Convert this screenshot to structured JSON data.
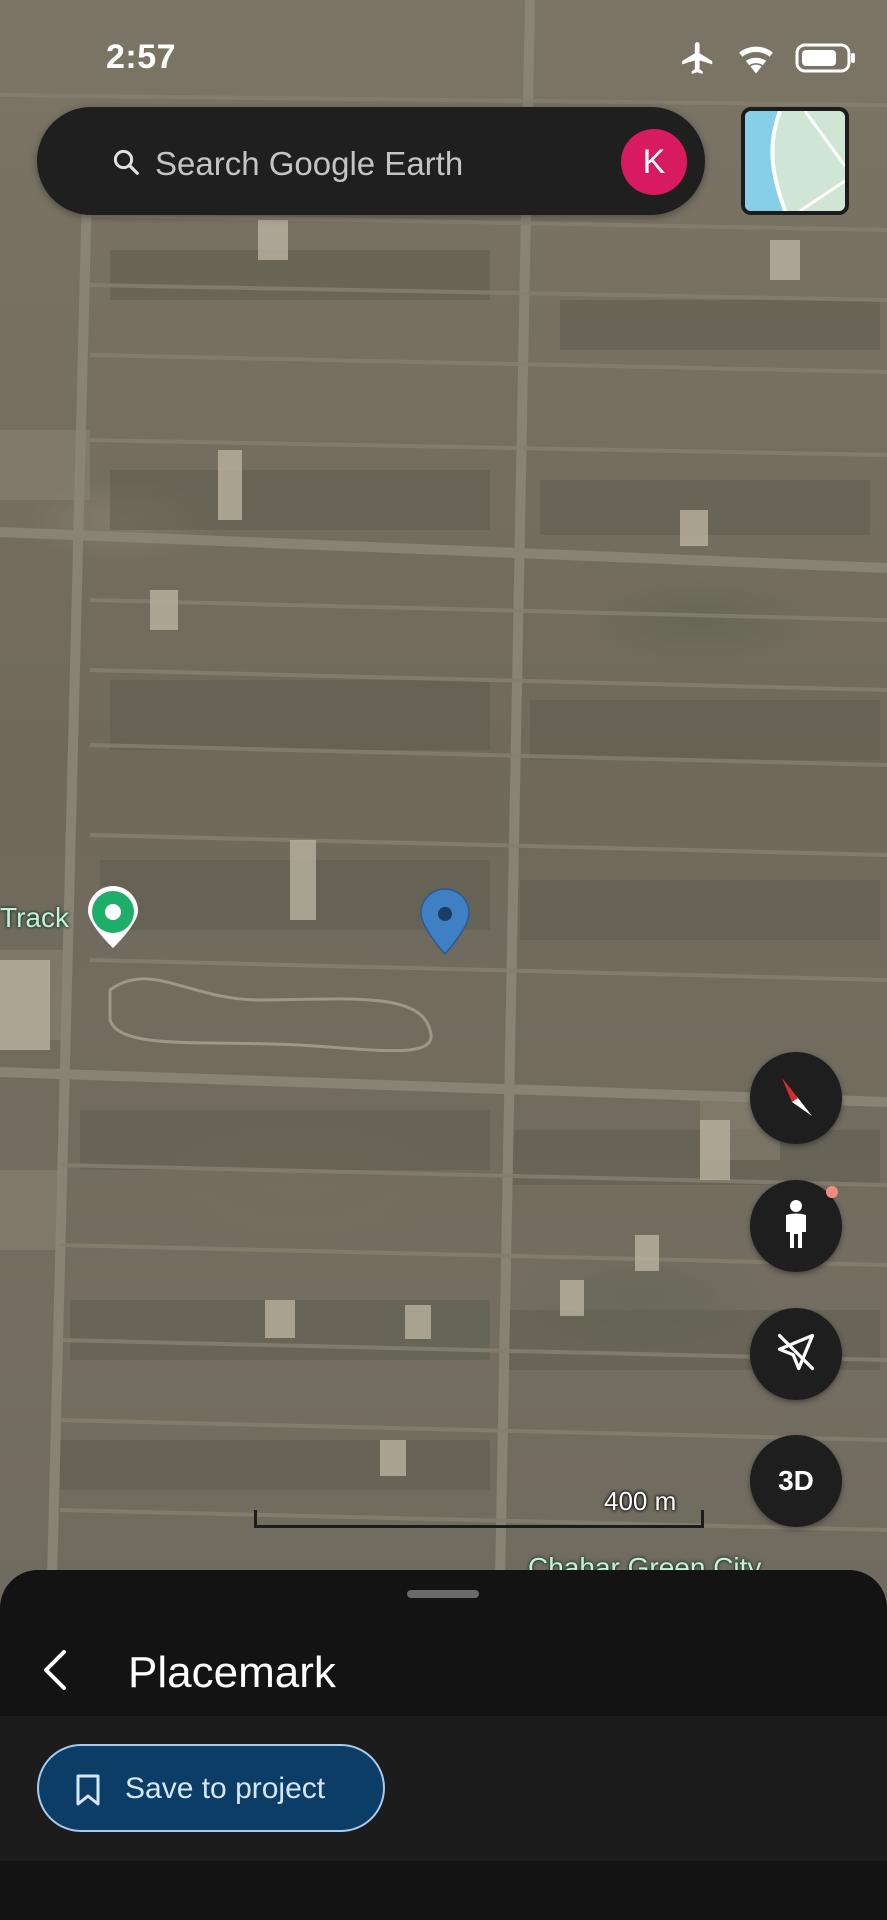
{
  "status_bar": {
    "time": "2:57",
    "icons": [
      "airplane-icon",
      "wifi-icon",
      "battery-icon"
    ]
  },
  "search": {
    "placeholder": "Search Google Earth",
    "avatar_letter": "K",
    "avatar_color": "#d81b60"
  },
  "map": {
    "labels": {
      "track": "Track",
      "green_city": "Chahar Green City"
    },
    "scale": "400 m"
  },
  "controls": {
    "compass": "compass-icon",
    "street_view": "pegman-icon",
    "location": "location-off-icon",
    "three_d_label": "3D"
  },
  "sheet": {
    "title": "Placemark",
    "save_label": "Save to project"
  },
  "colors": {
    "sheet_bg": "#131313",
    "save_button_bg": "#0b3d66",
    "save_button_border": "#a9c9ea",
    "placemark_pin": "#3f7fc4",
    "place_pin": "#1fae6a"
  }
}
